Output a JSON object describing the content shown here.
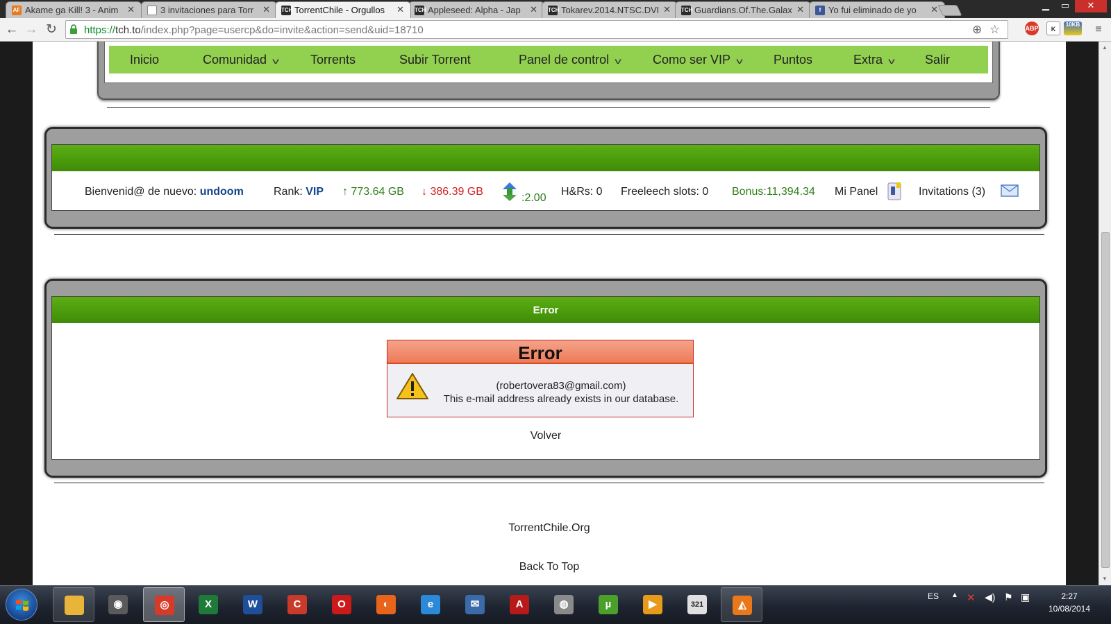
{
  "browser": {
    "tabs": [
      {
        "label": "Akame ga Kill! 3 - Anim",
        "favicon": "AF",
        "favicon_color": "#e67a1e",
        "active": false
      },
      {
        "label": "3 invitaciones para Torr",
        "favicon": "",
        "favicon_color": "#ffffff",
        "active": false
      },
      {
        "label": "TorrentChile - Orgullos",
        "favicon": "TCH",
        "favicon_color": "#2a2a2a",
        "active": true
      },
      {
        "label": "Appleseed: Alpha - Jap",
        "favicon": "TCH",
        "favicon_color": "#2a2a2a",
        "active": false
      },
      {
        "label": "Tokarev.2014.NTSC.DVD",
        "favicon": "TCH",
        "favicon_color": "#2a2a2a",
        "active": false
      },
      {
        "label": "Guardians.Of.The.Galax",
        "favicon": "TCH",
        "favicon_color": "#2a2a2a",
        "active": false
      },
      {
        "label": "Yo fui eliminado de yo",
        "favicon": "f",
        "favicon_color": "#3b5998",
        "active": false
      }
    ],
    "url_scheme": "https://",
    "url_host": "tch.to",
    "url_path": "/index.php?page=usercp&do=invite&action=send&uid=18710",
    "extension_abp": "ABP",
    "extension_k": "K",
    "extension_badge": "10KB"
  },
  "nav": {
    "items": [
      {
        "label": "Inicio",
        "dropdown": false
      },
      {
        "label": "Comunidad",
        "dropdown": true
      },
      {
        "label": "Torrents",
        "dropdown": false
      },
      {
        "label": "Subir Torrent",
        "dropdown": false
      },
      {
        "label": "Panel de control",
        "dropdown": true
      },
      {
        "label": "Como ser VIP",
        "dropdown": true
      },
      {
        "label": "Puntos",
        "dropdown": false
      },
      {
        "label": "Extra",
        "dropdown": true
      },
      {
        "label": "Salir",
        "dropdown": false
      }
    ]
  },
  "userbar": {
    "welcome_label": "Bienvenid@ de nuevo:",
    "username": "undoom",
    "rank_label": "Rank:",
    "rank_value": "VIP",
    "uploaded": "↑ 773.64 GB",
    "downloaded": "↓ 386.39 GB",
    "ratio": ":2.00",
    "hnr": "H&Rs: 0",
    "freeleech": "Freeleech slots: 0",
    "bonus": "Bonus:11,394.34",
    "panel_label": "Mi Panel",
    "invitations": "Invitations (3)"
  },
  "error_panel": {
    "title": "Error",
    "box_title": "Error",
    "email": "(robertovera83@gmail.com)",
    "message": "This e-mail address already exists in our database.",
    "back_link": "Volver"
  },
  "footer": {
    "site_name": "TorrentChile.Org",
    "back_to_top": "Back To Top"
  },
  "taskbar": {
    "language": "ES",
    "time": "2:27",
    "date": "10/08/2014",
    "apps": [
      {
        "name": "explorer",
        "glyph": "",
        "color": "#e8b53a"
      },
      {
        "name": "media",
        "glyph": "◉",
        "color": "#5a5a5a"
      },
      {
        "name": "chrome",
        "glyph": "◎",
        "color": "#d83a2a"
      },
      {
        "name": "excel",
        "glyph": "X",
        "color": "#1f7a3a"
      },
      {
        "name": "word",
        "glyph": "W",
        "color": "#1f4f9a"
      },
      {
        "name": "ccleaner",
        "glyph": "C",
        "color": "#c83a2a"
      },
      {
        "name": "opera",
        "glyph": "O",
        "color": "#cc1a1a"
      },
      {
        "name": "firefox",
        "glyph": "◐",
        "color": "#e8641a"
      },
      {
        "name": "ie",
        "glyph": "e",
        "color": "#2a8ad8"
      },
      {
        "name": "thunderbird",
        "glyph": "✉",
        "color": "#3a6aa8"
      },
      {
        "name": "acrobat",
        "glyph": "A",
        "color": "#b81a1a"
      },
      {
        "name": "imgburn",
        "glyph": "◍",
        "color": "#8a8a8a"
      },
      {
        "name": "utorrent",
        "glyph": "µ",
        "color": "#4aa02a"
      },
      {
        "name": "player",
        "glyph": "▶",
        "color": "#e89a1a"
      },
      {
        "name": "calendar",
        "glyph": "321",
        "color": "#e0e0e0"
      },
      {
        "name": "vlc",
        "glyph": "◭",
        "color": "#e8781a"
      }
    ]
  }
}
